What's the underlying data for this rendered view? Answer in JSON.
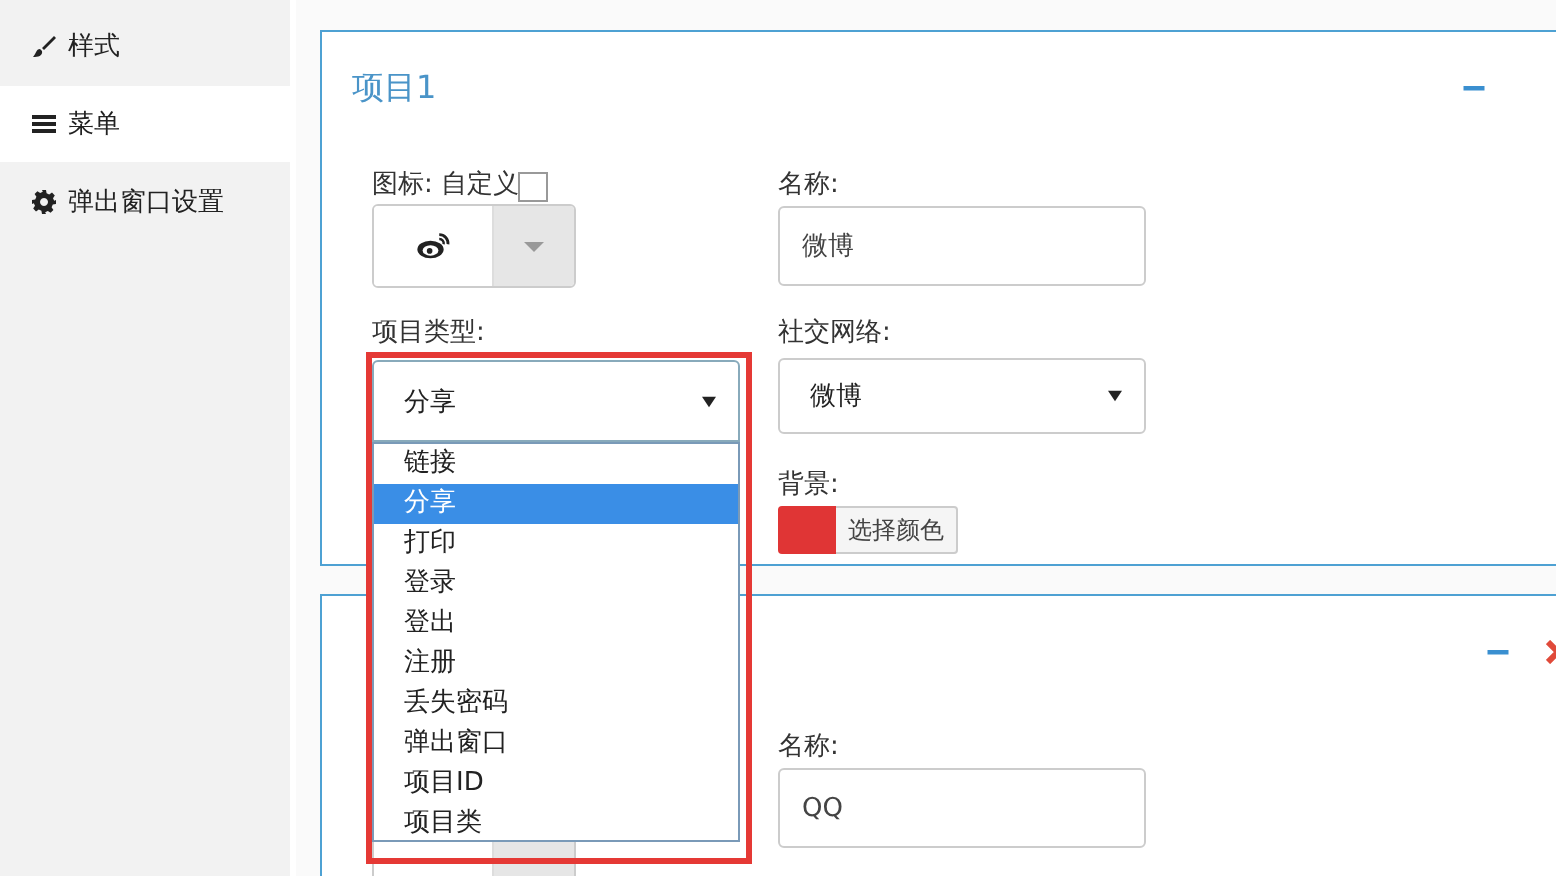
{
  "sidebar": {
    "items": [
      {
        "label": "样式",
        "selected": false
      },
      {
        "label": "菜单",
        "selected": true
      },
      {
        "label": "弹出窗口设置",
        "selected": false
      }
    ]
  },
  "panels": [
    {
      "title": "项目1",
      "removable": false,
      "icon_label": "图标:",
      "custom_label": "自定义",
      "custom_checked": false,
      "name_label": "名称:",
      "name_value": "微博",
      "type_label": "项目类型:",
      "type_value": "分享",
      "network_label": "社交网络:",
      "network_value": "微博",
      "background_label": "背景:",
      "color_button": "选择颜色"
    },
    {
      "removable": true,
      "name_label": "名称:",
      "name_value": "QQ"
    }
  ],
  "type_dropdown": {
    "options": [
      {
        "label": "链接",
        "selected": false
      },
      {
        "label": "分享",
        "selected": true
      },
      {
        "label": "打印",
        "selected": false
      },
      {
        "label": "登录",
        "selected": false
      },
      {
        "label": "登出",
        "selected": false
      },
      {
        "label": "注册",
        "selected": false
      },
      {
        "label": "丢失密码",
        "selected": false
      },
      {
        "label": "弹出窗口",
        "selected": false
      },
      {
        "label": "项目ID",
        "selected": false
      },
      {
        "label": "项目类",
        "selected": false
      }
    ]
  },
  "annotation": {
    "kind": "outline"
  }
}
